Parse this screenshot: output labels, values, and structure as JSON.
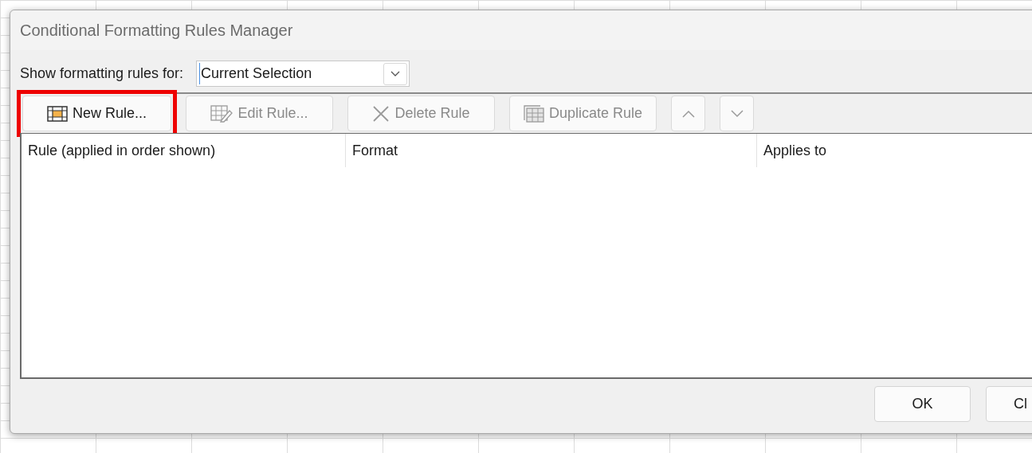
{
  "window": {
    "title": "Conditional Formatting Rules Manager"
  },
  "filter": {
    "label": "Show formatting rules for:",
    "value": "Current Selection"
  },
  "toolbar": [
    {
      "kind": "new",
      "label": "New Rule...",
      "disabled": false,
      "highlighted": true
    },
    {
      "kind": "edit",
      "label": "Edit Rule...",
      "disabled": true,
      "highlighted": false
    },
    {
      "kind": "delete",
      "label": "Delete Rule",
      "disabled": true,
      "highlighted": false
    },
    {
      "kind": "duplicate",
      "label": "Duplicate Rule",
      "disabled": true,
      "highlighted": false
    },
    {
      "kind": "up",
      "disabled": true,
      "highlighted": false
    },
    {
      "kind": "down",
      "disabled": true,
      "highlighted": false
    }
  ],
  "table": {
    "columns": [
      "Rule (applied in order shown)",
      "Format",
      "Applies to"
    ]
  },
  "buttons": [
    "OK",
    "Cl"
  ]
}
